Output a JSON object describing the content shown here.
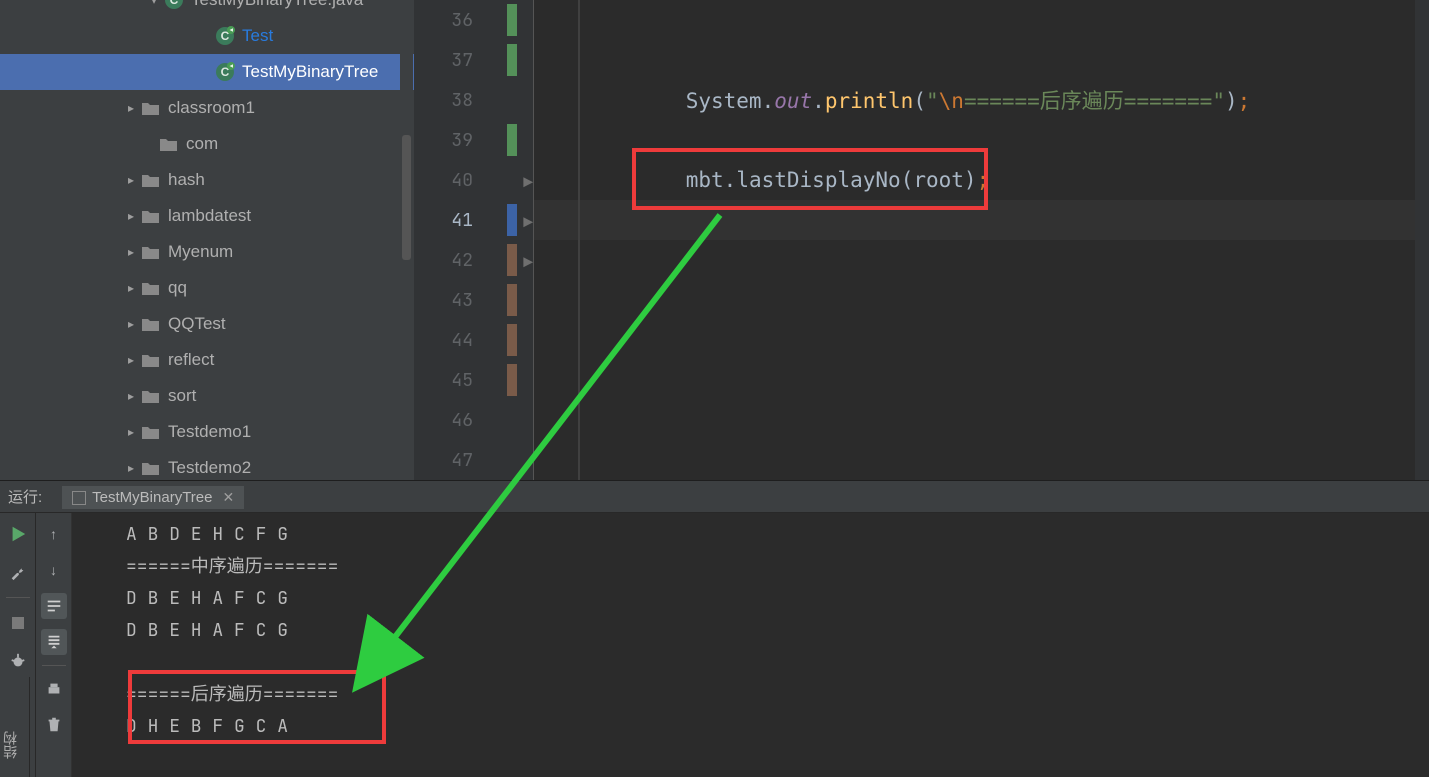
{
  "tree": {
    "items": [
      {
        "indent": 145,
        "chev": "down",
        "icon": "java",
        "label": "TestMyBinaryTree.java",
        "partial_top": true
      },
      {
        "indent": 196,
        "chev": "none",
        "icon": "class",
        "label": "Test"
      },
      {
        "indent": 196,
        "chev": "none",
        "icon": "class",
        "label": "TestMyBinaryTree",
        "selected": true
      },
      {
        "indent": 122,
        "chev": "right",
        "icon": "folder",
        "label": "classroom1"
      },
      {
        "indent": 140,
        "chev": "none",
        "icon": "folder",
        "label": "com"
      },
      {
        "indent": 122,
        "chev": "right",
        "icon": "folder",
        "label": "hash"
      },
      {
        "indent": 122,
        "chev": "right",
        "icon": "folder",
        "label": "lambdatest"
      },
      {
        "indent": 122,
        "chev": "right",
        "icon": "folder",
        "label": "Myenum"
      },
      {
        "indent": 122,
        "chev": "right",
        "icon": "folder",
        "label": "qq"
      },
      {
        "indent": 122,
        "chev": "right",
        "icon": "folder",
        "label": "QQTest"
      },
      {
        "indent": 122,
        "chev": "right",
        "icon": "folder",
        "label": "reflect"
      },
      {
        "indent": 122,
        "chev": "right",
        "icon": "folder",
        "label": "sort"
      },
      {
        "indent": 122,
        "chev": "right",
        "icon": "folder",
        "label": "Testdemo1"
      },
      {
        "indent": 122,
        "chev": "right",
        "icon": "folder",
        "label": "Testdemo2"
      }
    ]
  },
  "gutter": {
    "lines": [
      {
        "num": "36",
        "marker": "green"
      },
      {
        "num": "37",
        "marker": "green"
      },
      {
        "num": "38"
      },
      {
        "num": "39",
        "marker": "green"
      },
      {
        "num": "40",
        "play": true
      },
      {
        "num": "41",
        "current": true,
        "play": true,
        "marker": "blue"
      },
      {
        "num": "42",
        "play": true,
        "marker": "brown"
      },
      {
        "num": "43",
        "marker": "brown"
      },
      {
        "num": "44",
        "marker": "brown"
      },
      {
        "num": "45",
        "marker": "brown"
      },
      {
        "num": "46"
      },
      {
        "num": "47"
      }
    ]
  },
  "code38": {
    "prefix": "            System.",
    "out": "out",
    "dot": ".",
    "println": "println",
    "lpar": "(",
    "quote1": "\"",
    "esc": "\\n",
    "body": "======后序遍历=======",
    "quote2": "\"",
    "rpar": ")",
    "semi": ";"
  },
  "code40": {
    "indent": "            ",
    "obj": "mbt",
    "dot": ".",
    "method": "lastDisplayNo",
    "lpar": "(",
    "arg": "root",
    "rpar": ")",
    "semi": ";"
  },
  "run": {
    "title": "运行:",
    "tab_name": "TestMyBinaryTree",
    "struct_label": "结构"
  },
  "console_lines": [
    "A B D E H C F G ",
    "======中序遍历=======",
    "D B E H A F C G ",
    "D B E H A F C G ",
    "",
    "======后序遍历=======",
    "D H E B F G C A "
  ]
}
